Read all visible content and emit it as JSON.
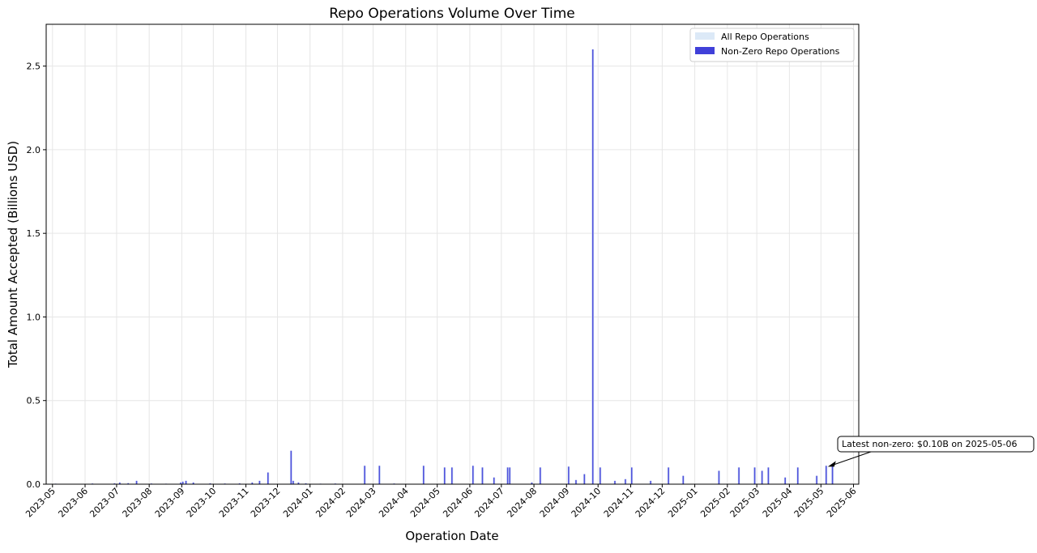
{
  "chart_data": {
    "type": "bar",
    "title": "Repo Operations Volume Over Time",
    "xlabel": "Operation Date",
    "ylabel": "Total Amount Accepted (Billions USD)",
    "x_ticks": [
      "2023-05",
      "2023-06",
      "2023-07",
      "2023-08",
      "2023-09",
      "2023-10",
      "2023-11",
      "2023-12",
      "2024-01",
      "2024-02",
      "2024-03",
      "2024-04",
      "2024-05",
      "2024-06",
      "2024-07",
      "2024-08",
      "2024-09",
      "2024-10",
      "2024-11",
      "2024-12",
      "2025-01",
      "2025-02",
      "2025-03",
      "2025-04",
      "2025-05",
      "2025-06"
    ],
    "xlim": [
      "2023-04-25",
      "2025-06-06"
    ],
    "ylim": [
      0,
      2.75
    ],
    "y_ticks": [
      "0.0",
      "0.5",
      "1.0",
      "1.5",
      "2.0",
      "2.5"
    ],
    "grid": true,
    "legend_placement": "top-right",
    "colors": {
      "all_ops": "#dce9f7",
      "nonzero_ops": "#4040d9"
    },
    "series": [
      {
        "name": "All Repo Operations",
        "points": [
          {
            "date": "2023-05-04",
            "value": 0.003
          },
          {
            "date": "2023-05-18",
            "value": 0.002
          },
          {
            "date": "2023-06-08",
            "value": 0.004
          },
          {
            "date": "2023-06-29",
            "value": 0.005
          },
          {
            "date": "2023-07-04",
            "value": 0.01
          },
          {
            "date": "2023-07-12",
            "value": 0.006
          },
          {
            "date": "2023-07-20",
            "value": 0.02
          },
          {
            "date": "2023-08-03",
            "value": 0.004
          },
          {
            "date": "2023-08-17",
            "value": 0.003
          },
          {
            "date": "2023-08-31",
            "value": 0.01
          },
          {
            "date": "2023-09-02",
            "value": 0.015
          },
          {
            "date": "2023-09-05",
            "value": 0.02
          },
          {
            "date": "2023-09-12",
            "value": 0.01
          },
          {
            "date": "2023-09-28",
            "value": 0.005
          },
          {
            "date": "2023-10-12",
            "value": 0.004
          },
          {
            "date": "2023-10-26",
            "value": 0.005
          },
          {
            "date": "2023-11-07",
            "value": 0.01
          },
          {
            "date": "2023-11-14",
            "value": 0.02
          },
          {
            "date": "2023-11-22",
            "value": 0.07
          },
          {
            "date": "2023-12-14",
            "value": 0.2
          },
          {
            "date": "2023-12-16",
            "value": 0.02
          },
          {
            "date": "2023-12-21",
            "value": 0.01
          },
          {
            "date": "2023-12-28",
            "value": 0.005
          },
          {
            "date": "2024-01-11",
            "value": 0.003
          },
          {
            "date": "2024-01-25",
            "value": 0.004
          },
          {
            "date": "2024-02-08",
            "value": 0.002
          },
          {
            "date": "2024-02-22",
            "value": 0.11
          },
          {
            "date": "2024-03-07",
            "value": 0.11
          },
          {
            "date": "2024-03-21",
            "value": 0.004
          },
          {
            "date": "2024-04-18",
            "value": 0.11
          },
          {
            "date": "2024-05-08",
            "value": 0.1
          },
          {
            "date": "2024-05-15",
            "value": 0.1
          },
          {
            "date": "2024-06-04",
            "value": 0.11
          },
          {
            "date": "2024-06-13",
            "value": 0.1
          },
          {
            "date": "2024-06-24",
            "value": 0.04
          },
          {
            "date": "2024-07-07",
            "value": 0.1
          },
          {
            "date": "2024-07-09",
            "value": 0.1
          },
          {
            "date": "2024-07-30",
            "value": 0.01
          },
          {
            "date": "2024-08-07",
            "value": 0.1
          },
          {
            "date": "2024-09-03",
            "value": 0.105
          },
          {
            "date": "2024-09-10",
            "value": 0.025
          },
          {
            "date": "2024-09-18",
            "value": 0.06
          },
          {
            "date": "2024-09-26",
            "value": 2.6
          },
          {
            "date": "2024-10-03",
            "value": 0.1
          },
          {
            "date": "2024-10-17",
            "value": 0.02
          },
          {
            "date": "2024-10-27",
            "value": 0.03
          },
          {
            "date": "2024-11-02",
            "value": 0.1
          },
          {
            "date": "2024-11-20",
            "value": 0.02
          },
          {
            "date": "2024-12-07",
            "value": 0.1
          },
          {
            "date": "2024-12-21",
            "value": 0.05
          },
          {
            "date": "2025-01-24",
            "value": 0.08
          },
          {
            "date": "2025-02-12",
            "value": 0.1
          },
          {
            "date": "2025-02-27",
            "value": 0.1
          },
          {
            "date": "2025-03-06",
            "value": 0.08
          },
          {
            "date": "2025-03-12",
            "value": 0.1
          },
          {
            "date": "2025-03-28",
            "value": 0.04
          },
          {
            "date": "2025-04-09",
            "value": 0.1
          },
          {
            "date": "2025-04-27",
            "value": 0.05
          },
          {
            "date": "2025-05-06",
            "value": 0.11
          },
          {
            "date": "2025-05-12",
            "value": 0.11
          }
        ]
      },
      {
        "name": "Non-Zero Repo Operations",
        "points": [
          {
            "date": "2023-05-04",
            "value": 0.003
          },
          {
            "date": "2023-05-18",
            "value": 0.002
          },
          {
            "date": "2023-06-08",
            "value": 0.004
          },
          {
            "date": "2023-06-29",
            "value": 0.005
          },
          {
            "date": "2023-07-04",
            "value": 0.01
          },
          {
            "date": "2023-07-12",
            "value": 0.006
          },
          {
            "date": "2023-07-20",
            "value": 0.02
          },
          {
            "date": "2023-08-03",
            "value": 0.004
          },
          {
            "date": "2023-08-17",
            "value": 0.003
          },
          {
            "date": "2023-08-31",
            "value": 0.01
          },
          {
            "date": "2023-09-02",
            "value": 0.015
          },
          {
            "date": "2023-09-05",
            "value": 0.02
          },
          {
            "date": "2023-09-12",
            "value": 0.01
          },
          {
            "date": "2023-09-28",
            "value": 0.005
          },
          {
            "date": "2023-10-12",
            "value": 0.004
          },
          {
            "date": "2023-10-26",
            "value": 0.005
          },
          {
            "date": "2023-11-07",
            "value": 0.01
          },
          {
            "date": "2023-11-14",
            "value": 0.02
          },
          {
            "date": "2023-11-22",
            "value": 0.07
          },
          {
            "date": "2023-12-14",
            "value": 0.2
          },
          {
            "date": "2023-12-16",
            "value": 0.02
          },
          {
            "date": "2023-12-21",
            "value": 0.01
          },
          {
            "date": "2023-12-28",
            "value": 0.005
          },
          {
            "date": "2024-01-11",
            "value": 0.003
          },
          {
            "date": "2024-01-25",
            "value": 0.004
          },
          {
            "date": "2024-02-08",
            "value": 0.002
          },
          {
            "date": "2024-02-22",
            "value": 0.11
          },
          {
            "date": "2024-03-07",
            "value": 0.11
          },
          {
            "date": "2024-03-21",
            "value": 0.004
          },
          {
            "date": "2024-04-18",
            "value": 0.11
          },
          {
            "date": "2024-05-08",
            "value": 0.1
          },
          {
            "date": "2024-05-15",
            "value": 0.1
          },
          {
            "date": "2024-06-04",
            "value": 0.11
          },
          {
            "date": "2024-06-13",
            "value": 0.1
          },
          {
            "date": "2024-06-24",
            "value": 0.04
          },
          {
            "date": "2024-07-07",
            "value": 0.1
          },
          {
            "date": "2024-07-09",
            "value": 0.1
          },
          {
            "date": "2024-07-30",
            "value": 0.01
          },
          {
            "date": "2024-08-07",
            "value": 0.1
          },
          {
            "date": "2024-09-03",
            "value": 0.105
          },
          {
            "date": "2024-09-10",
            "value": 0.025
          },
          {
            "date": "2024-09-18",
            "value": 0.06
          },
          {
            "date": "2024-09-26",
            "value": 2.6
          },
          {
            "date": "2024-10-03",
            "value": 0.1
          },
          {
            "date": "2024-10-17",
            "value": 0.02
          },
          {
            "date": "2024-10-27",
            "value": 0.03
          },
          {
            "date": "2024-11-02",
            "value": 0.1
          },
          {
            "date": "2024-11-20",
            "value": 0.02
          },
          {
            "date": "2024-12-07",
            "value": 0.1
          },
          {
            "date": "2024-12-21",
            "value": 0.05
          },
          {
            "date": "2025-01-24",
            "value": 0.08
          },
          {
            "date": "2025-02-12",
            "value": 0.1
          },
          {
            "date": "2025-02-27",
            "value": 0.1
          },
          {
            "date": "2025-03-06",
            "value": 0.08
          },
          {
            "date": "2025-03-12",
            "value": 0.1
          },
          {
            "date": "2025-03-28",
            "value": 0.04
          },
          {
            "date": "2025-04-09",
            "value": 0.1
          },
          {
            "date": "2025-04-27",
            "value": 0.05
          },
          {
            "date": "2025-05-06",
            "value": 0.11
          },
          {
            "date": "2025-05-12",
            "value": 0.11
          }
        ]
      }
    ],
    "annotation": {
      "text": "Latest non-zero: $0.10B on 2025-05-06",
      "target_date": "2025-05-06",
      "target_value": 0.1
    }
  }
}
